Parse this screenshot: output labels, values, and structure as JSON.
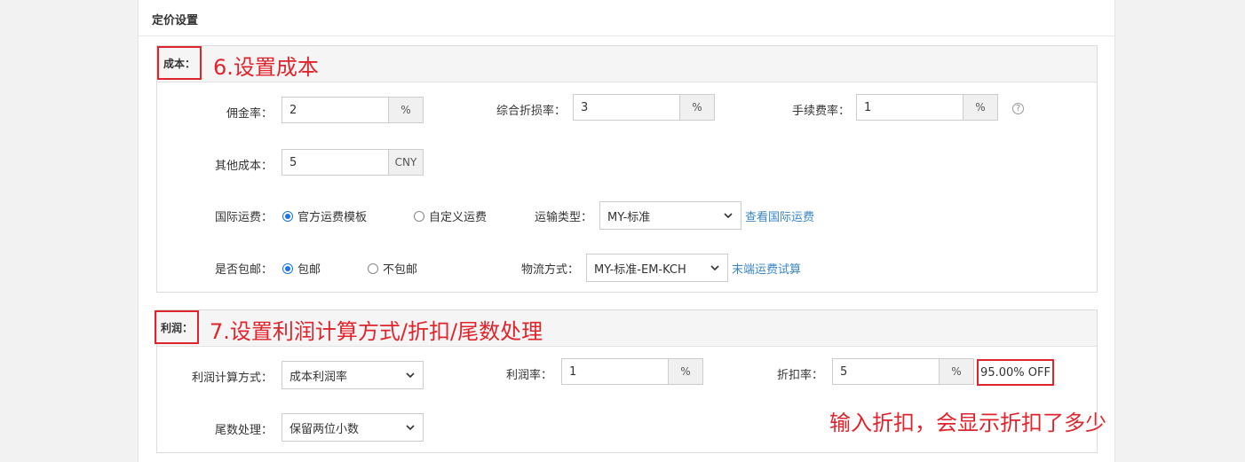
{
  "panel": {
    "title": "定价设置"
  },
  "cost": {
    "label": "成本：",
    "note": "6.设置成本",
    "commission": {
      "label": "佣金率：",
      "value": "2",
      "unit": "%"
    },
    "discount_loss": {
      "label": "综合折损率：",
      "value": "3",
      "unit": "%"
    },
    "fee": {
      "label": "手续费率：",
      "value": "1",
      "unit": "%",
      "help": "?"
    },
    "other": {
      "label": "其他成本：",
      "value": "5",
      "unit": "CNY"
    },
    "intl_shipping": {
      "label": "国际运费：",
      "options": [
        "官方运费模板",
        "自定义运费"
      ],
      "selected": "官方运费模板"
    },
    "transport_type": {
      "label": "运输类型：",
      "value": "MY-标准",
      "link": "查看国际运费"
    },
    "free_shipping": {
      "label": "是否包邮：",
      "options": [
        "包邮",
        "不包邮"
      ],
      "selected": "包邮"
    },
    "logistics": {
      "label": "物流方式：",
      "value": "MY-标准-EM-KCH",
      "link": "末端运费试算"
    }
  },
  "profit": {
    "label": "利润：",
    "note": "7.设置利润计算方式/折扣/尾数处理",
    "method": {
      "label": "利润计算方式：",
      "value": "成本利润率"
    },
    "rate": {
      "label": "利润率：",
      "value": "1",
      "unit": "%"
    },
    "discount": {
      "label": "折扣率：",
      "value": "5",
      "unit": "%",
      "result": "95.00% OFF"
    },
    "rounding": {
      "label": "尾数处理：",
      "value": "保留两位小数"
    }
  },
  "annotation": "输入折扣，会显示折扣了多少",
  "colors": {
    "accent_red": "#e0242c",
    "link_blue": "#3a85c6",
    "radio_blue": "#1a73e8"
  }
}
